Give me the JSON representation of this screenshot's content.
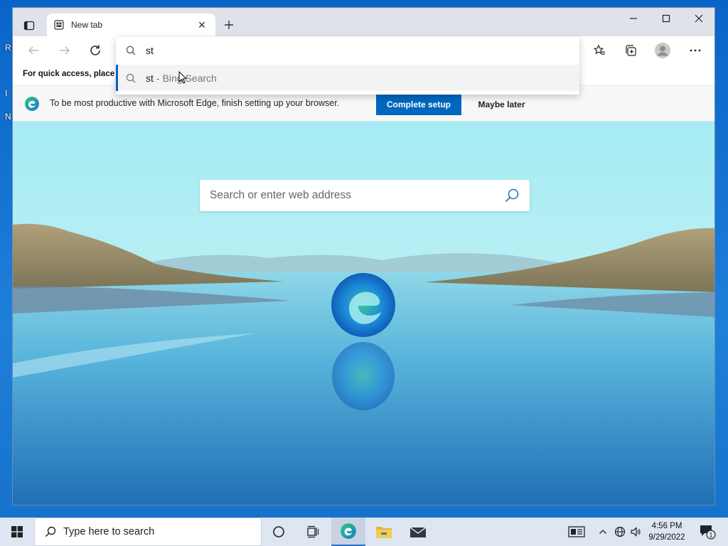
{
  "desktop": {
    "icon_label_1": "R",
    "icon_label_2": "I",
    "icon_label_3": "N"
  },
  "browser": {
    "tab": {
      "title": "New tab"
    },
    "favorites_bar": {
      "text": "For quick access, place y"
    },
    "address_bar": {
      "value": "st"
    },
    "suggestion": {
      "query": "st",
      "separator": "-",
      "engine": "Bing Search"
    },
    "banner": {
      "message": "To be most productive with Microsoft Edge, finish setting up your browser.",
      "primary_button": "Complete setup",
      "secondary_button": "Maybe later"
    },
    "ntp": {
      "search_placeholder": "Search or enter web address"
    },
    "accent_color": "#0067c0"
  },
  "taskbar": {
    "search_text": "Type here to search",
    "clock_time": "4:56 PM",
    "clock_date": "9/29/2022",
    "notification_count": "1"
  },
  "icons": [
    "tab-actions-icon",
    "close-icon",
    "plus-icon",
    "minimize-icon",
    "maximize-icon",
    "back-icon",
    "forward-icon",
    "refresh-icon",
    "search-icon",
    "favorites-icon",
    "collections-icon",
    "profile-icon",
    "more-icon",
    "edge-logo-icon",
    "windows-start-icon",
    "task-view-icon",
    "file-explorer-icon",
    "mail-icon",
    "news-icon",
    "chevron-up-icon",
    "network-icon",
    "volume-icon",
    "notification-icon"
  ]
}
